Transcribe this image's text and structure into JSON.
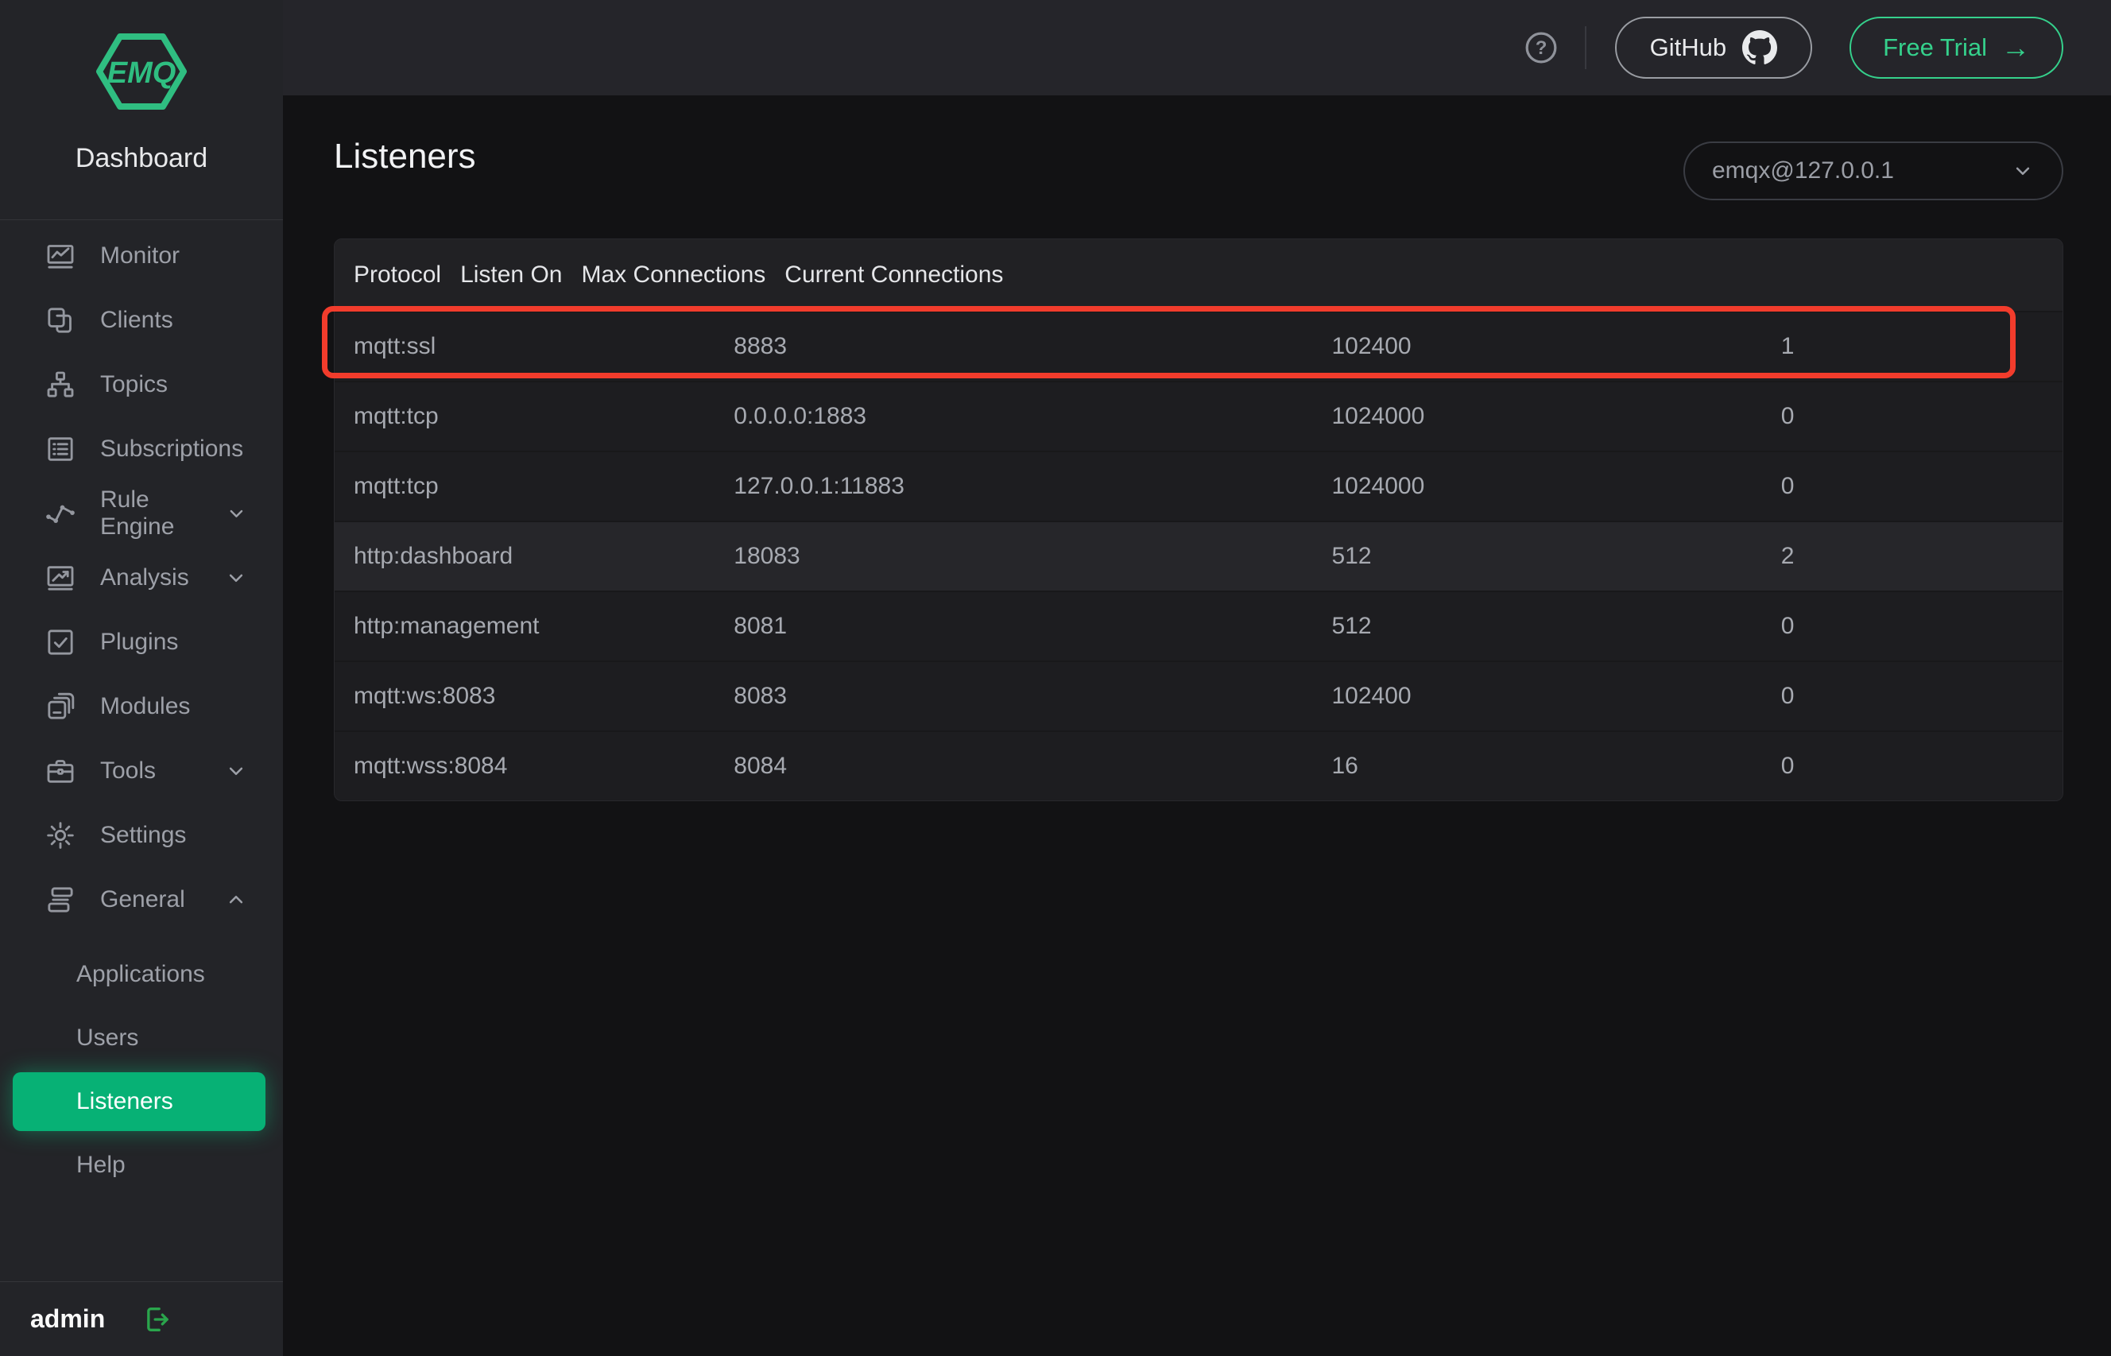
{
  "brand": {
    "logo_text": "EMQ",
    "title": "Dashboard"
  },
  "header": {
    "help_icon": "help-circle-icon",
    "github_label": "GitHub",
    "github_icon": "github-icon",
    "free_trial_label": "Free Trial",
    "free_trial_arrow": "→"
  },
  "page": {
    "title": "Listeners",
    "node_select_value": "emqx@127.0.0.1"
  },
  "sidebar": {
    "items": [
      {
        "label": "Monitor",
        "icon": "monitor-icon"
      },
      {
        "label": "Clients",
        "icon": "clients-icon"
      },
      {
        "label": "Topics",
        "icon": "topics-icon"
      },
      {
        "label": "Subscriptions",
        "icon": "subscriptions-icon"
      },
      {
        "label": "Rule Engine",
        "icon": "rule-engine-icon",
        "expandable": true,
        "state": "collapsed"
      },
      {
        "label": "Analysis",
        "icon": "analysis-icon",
        "expandable": true,
        "state": "collapsed"
      },
      {
        "label": "Plugins",
        "icon": "plugins-icon"
      },
      {
        "label": "Modules",
        "icon": "modules-icon"
      },
      {
        "label": "Tools",
        "icon": "tools-icon",
        "expandable": true,
        "state": "collapsed"
      },
      {
        "label": "Settings",
        "icon": "settings-icon"
      },
      {
        "label": "General",
        "icon": "general-icon",
        "expandable": true,
        "state": "expanded"
      }
    ],
    "general_children": [
      {
        "label": "Applications"
      },
      {
        "label": "Users"
      },
      {
        "label": "Listeners",
        "active": true
      },
      {
        "label": "Help"
      }
    ],
    "user": {
      "name": "admin",
      "logout_icon": "logout-icon"
    }
  },
  "table": {
    "columns": [
      "Protocol",
      "Listen On",
      "Max Connections",
      "Current Connections"
    ],
    "rows": [
      {
        "protocol": "mqtt:ssl",
        "listen_on": "8883",
        "max_connections": "102400",
        "current_connections": "1",
        "annotated": true
      },
      {
        "protocol": "mqtt:tcp",
        "listen_on": "0.0.0.0:1883",
        "max_connections": "1024000",
        "current_connections": "0"
      },
      {
        "protocol": "mqtt:tcp",
        "listen_on": "127.0.0.1:11883",
        "max_connections": "1024000",
        "current_connections": "0"
      },
      {
        "protocol": "http:dashboard",
        "listen_on": "18083",
        "max_connections": "512",
        "current_connections": "2",
        "hovered": true
      },
      {
        "protocol": "http:management",
        "listen_on": "8081",
        "max_connections": "512",
        "current_connections": "0"
      },
      {
        "protocol": "mqtt:ws:8083",
        "listen_on": "8083",
        "max_connections": "102400",
        "current_connections": "0"
      },
      {
        "protocol": "mqtt:wss:8084",
        "listen_on": "8084",
        "max_connections": "16",
        "current_connections": "0"
      }
    ]
  },
  "colors": {
    "brand_green": "#2fbe81",
    "active_item_green": "#07b175",
    "free_trial_green": "#35d18c",
    "logout_green": "#2aa54c",
    "annotation_red": "#f23c2c",
    "sidebar_bg": "#232428",
    "topbar_bg": "#25252a",
    "content_bg": "#121214",
    "table_bg": "#1d1d20"
  }
}
